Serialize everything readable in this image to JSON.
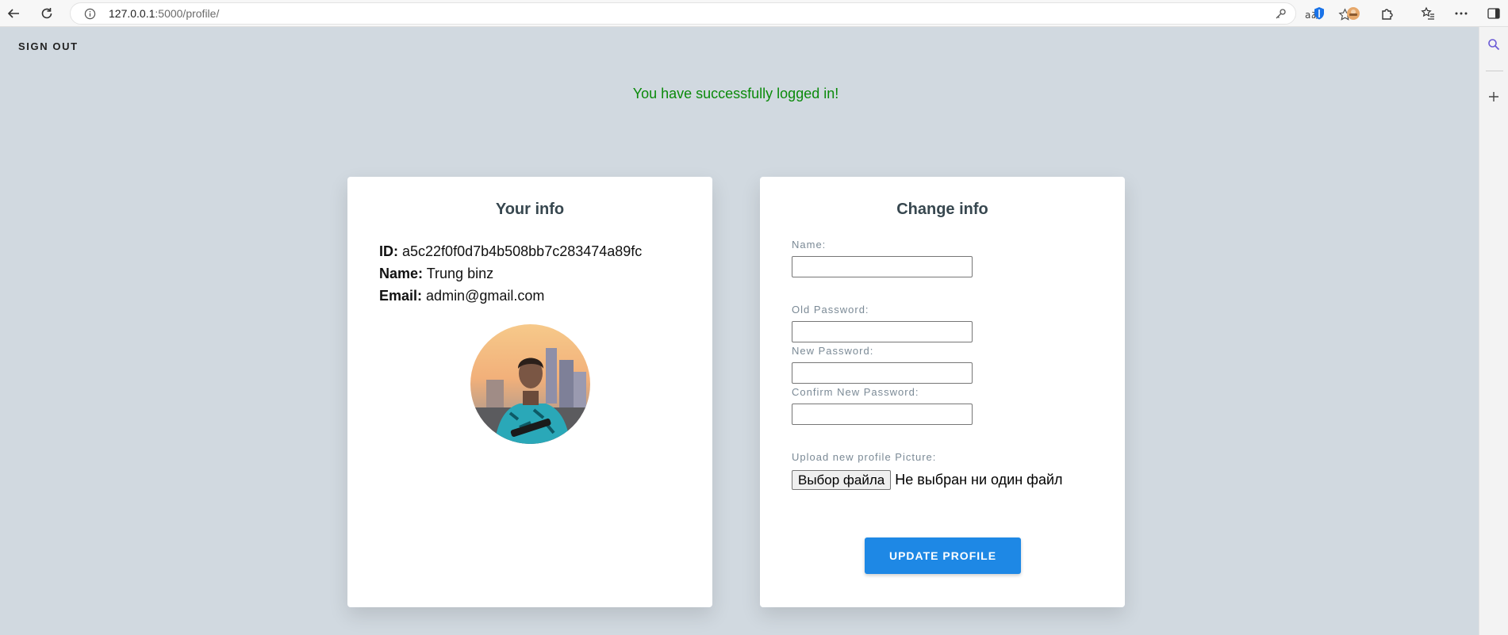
{
  "browser": {
    "url_host": "127.0.0.1",
    "url_path": ":5000/profile/"
  },
  "page": {
    "signout_label": "SIGN OUT",
    "flash_message": "You have successfully logged in!"
  },
  "your_info": {
    "title": "Your info",
    "id_label": "ID:",
    "id_value": "a5c22f0f0d7b4b508bb7c283474a89fc",
    "name_label": "Name:",
    "name_value": "Trung binz",
    "email_label": "Email:",
    "email_value": "admin@gmail.com"
  },
  "change_info": {
    "title": "Change info",
    "name_label": "Name:",
    "old_password_label": "Old Password:",
    "new_password_label": "New Password:",
    "confirm_password_label": "Confirm New Password:",
    "upload_label": "Upload new profile Picture:",
    "file_button_label": "Выбор файла",
    "file_status": "Не выбран ни один файл",
    "submit_label": "UPDATE PROFILE"
  },
  "colors": {
    "page_bg": "#d1d9e0",
    "flash": "#0a8a0a",
    "button": "#1e88e5",
    "card_title": "#37474f"
  }
}
